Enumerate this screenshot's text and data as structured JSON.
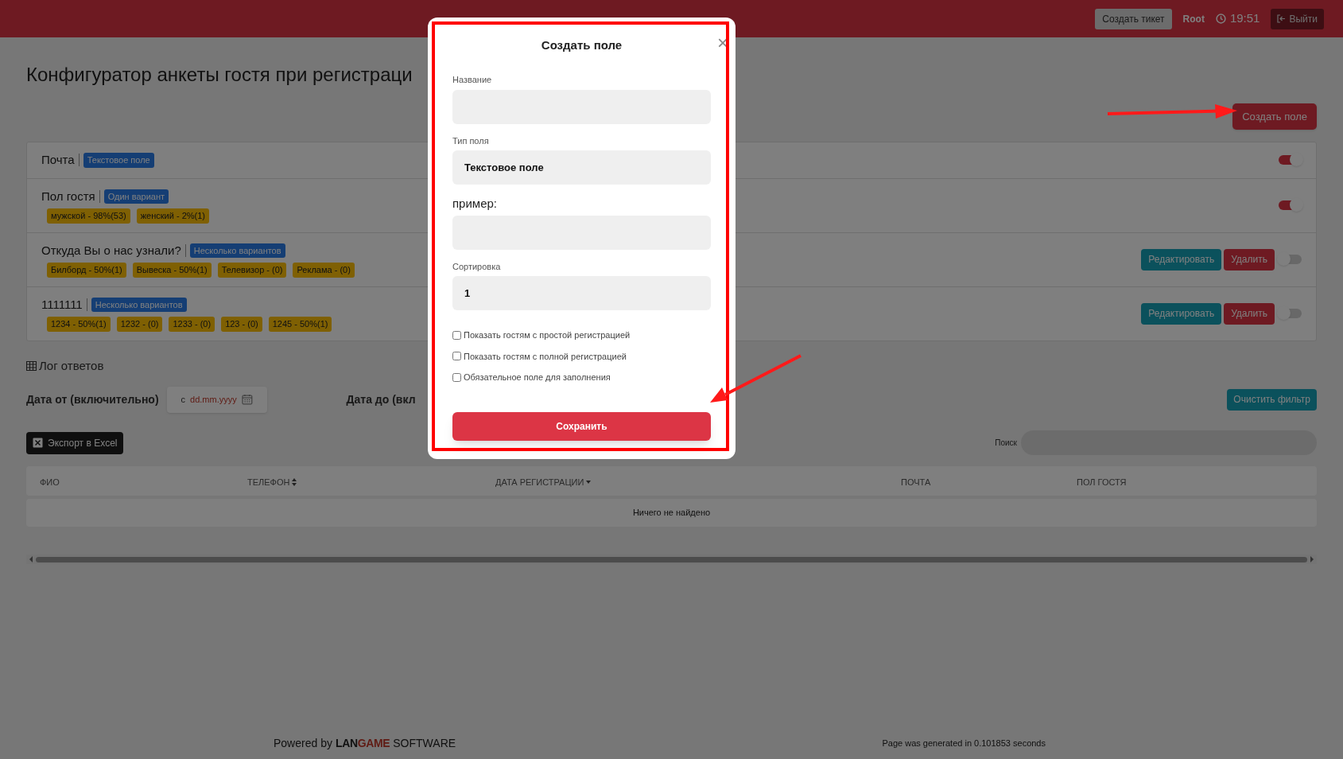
{
  "header": {
    "ticket_button": "Создать тикет",
    "user": "Root",
    "time": "19:51",
    "logout_button": "Выйти"
  },
  "page_title": "Конфигуратор анкеты гостя при регистраци",
  "create_button": "Создать поле",
  "fields": [
    {
      "name": "Почта",
      "type": "Текстовое поле",
      "enabled": true
    },
    {
      "name": "Пол гостя",
      "type": "Один вариант",
      "options": [
        "мужской - 98%(53)",
        "женский - 2%(1)"
      ],
      "enabled": true
    },
    {
      "name": "Откуда Вы о нас узнали?",
      "type": "Несколько вариантов",
      "options": [
        "Билборд - 50%(1)",
        "Вывеска - 50%(1)",
        "Телевизор - (0)",
        "Реклама - (0)"
      ],
      "buttons": [
        "Редактировать",
        "Удалить"
      ],
      "enabled": false
    },
    {
      "name": "1111111",
      "type": "Несколько вариантов",
      "options": [
        "1234 - 50%(1)",
        "1232 - (0)",
        "1233 - (0)",
        "123 - (0)",
        "1245 - 50%(1)"
      ],
      "buttons": [
        "Редактировать",
        "Удалить"
      ],
      "enabled": false
    }
  ],
  "log": {
    "title": "Лог ответов",
    "date_from_label": "Дата от (включительно)",
    "date_from_prefix": "с",
    "date_from_placeholder": "dd.mm.yyyy",
    "date_to_label": "Дата до (вкл",
    "clear_button": "Очистить фильтр",
    "export_button": "Экспорт в Excel",
    "search_label": "Поиск",
    "columns": [
      {
        "label": "ФИО",
        "kind": "plain"
      },
      {
        "label": "ТЕЛЕФОН",
        "kind": "sortable"
      },
      {
        "label": "ДАТА РЕГИСТРАЦИИ",
        "kind": "sorted"
      },
      {
        "label": "ПОЧТА",
        "kind": "plain"
      },
      {
        "label": "ПОЛ ГОСТЯ",
        "kind": "plain"
      }
    ],
    "empty_message": "Ничего не найдено"
  },
  "footer": {
    "powered_prefix": "Powered by",
    "brand_first": "LAN",
    "brand_second": "GAME",
    "brand_suffix": "SOFTWARE",
    "generated": "Page was generated in 0.101853 seconds"
  },
  "modal": {
    "title": "Создать поле",
    "close": "×",
    "inputs": [
      {
        "label": "Название",
        "kind": "small"
      },
      {
        "label": "Тип поля",
        "kind": "small",
        "value": "Текстовое поле"
      },
      {
        "label": "пример:",
        "kind": "large"
      },
      {
        "label": "Сортировка",
        "kind": "small",
        "value": "1"
      }
    ],
    "checkboxes": [
      {
        "label": "Показать гостям с простой регистрацией",
        "checked": false
      },
      {
        "label": "Показать гостям с полной регистрацией",
        "checked": false
      },
      {
        "label": "Обязательное поле для заполнения",
        "checked": false
      }
    ],
    "save_button": "Сохранить"
  }
}
